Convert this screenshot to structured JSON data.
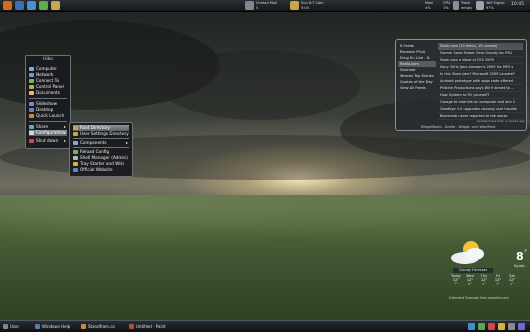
{
  "top_panel": {
    "launchers": [
      {
        "icon": "firefox-icon",
        "color": "#d86a1e"
      },
      {
        "icon": "thunderbird-icon",
        "color": "#3c6fb5"
      },
      {
        "icon": "document-icon",
        "color": "#4a8fd0"
      },
      {
        "icon": "spreadsheet-icon",
        "color": "#5fae4c"
      },
      {
        "icon": "folder-icon",
        "color": "#c9a54b"
      }
    ],
    "indicators": [
      {
        "icon": "mail-icon",
        "label": "Unread Mail",
        "value": "0"
      },
      {
        "icon": "bell-icon",
        "label": "Sun 8:7 Cam",
        "value": "5:04"
      }
    ],
    "system": [
      {
        "label": "Main",
        "value": "4%"
      },
      {
        "label": "CPU",
        "value": "1%"
      },
      {
        "label": "Trash",
        "value": "empty"
      },
      {
        "label": "Wifi Signal",
        "value": "97%"
      }
    ],
    "clock": "10:45"
  },
  "main_menu": {
    "title": "Hiko",
    "items": [
      {
        "label": "Computer",
        "icon": "computer-icon"
      },
      {
        "label": "Network",
        "icon": "network-icon"
      },
      {
        "label": "Connect To",
        "icon": "connect-icon"
      },
      {
        "label": "Control Panel",
        "icon": "control-panel-icon"
      },
      {
        "label": "Documents",
        "icon": "documents-icon"
      },
      {
        "label": "Slideshow",
        "icon": "slideshow-icon"
      },
      {
        "label": "Desktop",
        "icon": "desktop-icon"
      },
      {
        "label": "Quick Launch",
        "icon": "quick-launch-icon"
      },
      {
        "label": "Share",
        "icon": "share-icon"
      },
      {
        "label": "Configuration",
        "icon": "configuration-icon"
      },
      {
        "label": "Shut down",
        "icon": "shutdown-icon"
      }
    ]
  },
  "config_submenu": {
    "items": [
      {
        "label": "Root Directory"
      },
      {
        "label": "User Settings Directory"
      },
      {
        "label": "Components"
      },
      {
        "label": "Reload Config"
      },
      {
        "label": "Shell Manager (Admin)"
      },
      {
        "label": "Tray Starter and Wiki"
      },
      {
        "label": "Official Website"
      }
    ]
  },
  "feed_widget": {
    "sidebar": [
      "8 Feeds",
      "Renewix P5x0",
      "Drug En Line - N",
      "Radio.com",
      "Slashdot",
      "Wrecks Top Stories",
      "Quotes of the Day",
      "View All Feeds"
    ],
    "headlines": [
      "Slash.com (10 items, 15 unread)",
      "Former Sonic Raiser Zero Gravity for PSG",
      "Slash.com a Word of CES 2009",
      "Sony 30Hz Jpno Amazon's 2009 Inc MP3 s",
      "In this Store Joke? Microsoft 2009 Laurate?",
      "Android prototype with apps code offered",
      "Pristine Productions says Wii fi aimed to ...",
      "How System to Fill yourself?",
      "Garage to Interlink on computer and aim 2",
      "Goodbye 4.0 upgrades causing user trouble",
      "Blackmob never reported to the works"
    ],
    "footer_left": "WidgetWorks - Drofile - Widget .com Web/Feed",
    "footer_right": "Updated less than a minute ago"
  },
  "weather": {
    "temp": "8",
    "unit": "°",
    "location": "Kyoto",
    "condition": "Cloudy Forecast",
    "days": [
      {
        "name": "Today",
        "high": "12°",
        "low": "7°"
      },
      {
        "name": "Wed",
        "high": "12°",
        "low": "6°"
      },
      {
        "name": "Thu",
        "high": "12°",
        "low": "4°"
      },
      {
        "name": "Fri",
        "high": "12°",
        "low": "3°"
      },
      {
        "name": "Sat",
        "high": "12°",
        "low": "2°"
      }
    ],
    "footer": "Extended Forecast from weather.com"
  },
  "taskbar": {
    "tasks": [
      {
        "label": "User",
        "color": "#7a8a9a"
      },
      {
        "label": "Windows Help",
        "color": "#5a7ab0"
      },
      {
        "label": "Standfrom.co",
        "color": "#c7893b"
      },
      {
        "label": "Untitled - Paint",
        "color": "#b04b4b"
      }
    ],
    "tray": [
      "#3a8fd0",
      "#5aa84c",
      "#c74b4b",
      "#d6b23e",
      "#8a8a8a",
      "#6a6ad0"
    ]
  }
}
